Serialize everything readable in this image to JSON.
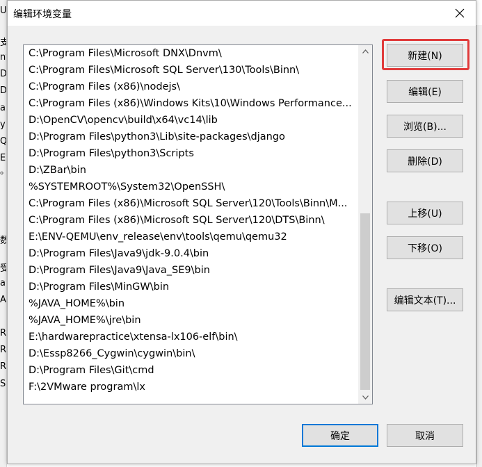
{
  "background": {
    "left_fragments": [
      "U",
      "支",
      "nt",
      "Dr",
      "Dr",
      "a",
      "y",
      "QT",
      "E",
      "。",
      "数",
      "受",
      "a",
      "A",
      "R",
      "R",
      "R",
      "S"
    ]
  },
  "dialog": {
    "title": "编辑环境变量",
    "close_icon": "close-icon"
  },
  "list": {
    "items": [
      "C:\\Program Files\\Microsoft DNX\\Dnvm\\",
      "C:\\Program Files\\Microsoft SQL Server\\130\\Tools\\Binn\\",
      "C:\\Program Files (x86)\\nodejs\\",
      "C:\\Program Files (x86)\\Windows Kits\\10\\Windows Performance...",
      "D:\\OpenCV\\opencv\\build\\x64\\vc14\\lib",
      "D:\\Program Files\\python3\\Lib\\site-packages\\django",
      "D:\\Program Files\\python3\\Scripts",
      "D:\\ZBar\\bin",
      "%SYSTEMROOT%\\System32\\OpenSSH\\",
      "C:\\Program Files (x86)\\Microsoft SQL Server\\120\\Tools\\Binn\\M...",
      "C:\\Program Files (x86)\\Microsoft SQL Server\\120\\DTS\\Binn\\",
      "E:\\ENV-QEMU\\env_release\\env\\tools\\qemu\\qemu32",
      "D:\\Program Files\\Java9\\jdk-9.0.4\\bin",
      "D:\\Program Files\\Java9\\Java_SE9\\bin",
      "D:\\Program Files\\MinGW\\bin",
      "%JAVA_HOME%\\bin",
      "%JAVA_HOME%\\jre\\bin",
      "E:\\hardwarepractice\\xtensa-lx106-elf\\bin\\",
      "D:\\Essp8266_Cygwin\\cygwin\\bin\\",
      "D:\\Program Files\\Git\\cmd",
      "F:\\2VMware program\\lx"
    ],
    "scroll_up_icon": "chevron-up-icon",
    "scroll_down_icon": "chevron-down-icon"
  },
  "buttons": {
    "new": "新建(N)",
    "edit": "编辑(E)",
    "browse": "浏览(B)...",
    "delete": "删除(D)",
    "move_up": "上移(U)",
    "move_down": "下移(O)",
    "edit_text": "编辑文本(T)...",
    "ok": "确定",
    "cancel": "取消"
  },
  "colors": {
    "highlight": "#e03b3b",
    "focus_border": "#0078d7",
    "dialog_bg": "#f0f0f0"
  }
}
